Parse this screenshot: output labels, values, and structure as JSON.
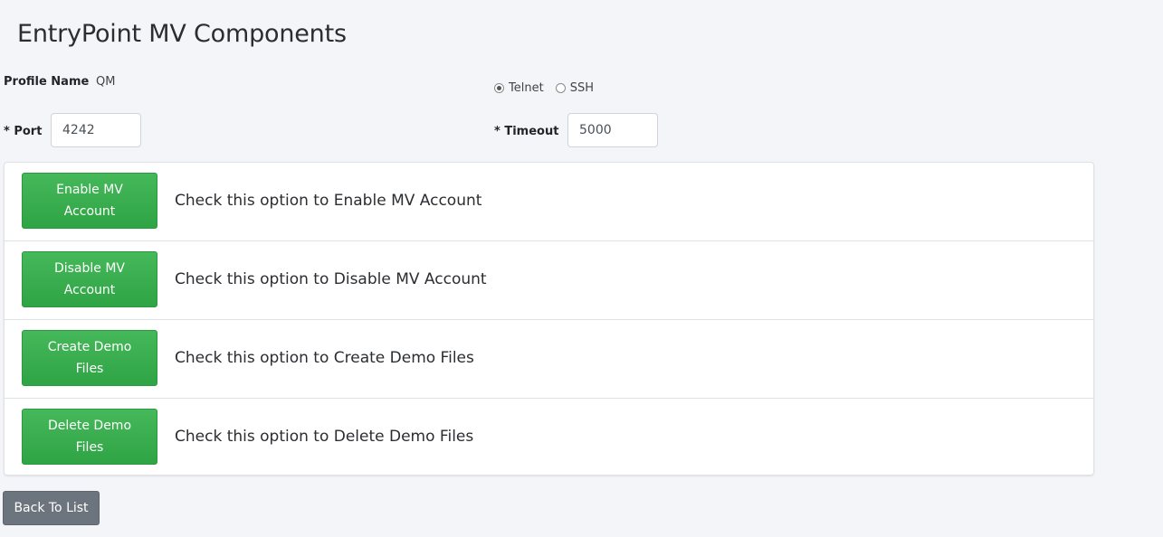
{
  "page": {
    "title": "EntryPoint MV Components"
  },
  "profile": {
    "label": "Profile Name",
    "value": "QM"
  },
  "protocol": {
    "options": [
      {
        "label": "Telnet",
        "checked": true
      },
      {
        "label": "SSH",
        "checked": false
      }
    ]
  },
  "port": {
    "label": "* Port",
    "value": "4242"
  },
  "timeout": {
    "label": "* Timeout",
    "value": "5000"
  },
  "actions": [
    {
      "button_label": "Enable MV Account",
      "description": "Check this option to Enable MV Account"
    },
    {
      "button_label": "Disable MV Account",
      "description": "Check this option to Disable MV Account"
    },
    {
      "button_label": "Create Demo Files",
      "description": "Check this option to Create Demo Files"
    },
    {
      "button_label": "Delete Demo Files",
      "description": "Check this option to Delete Demo Files"
    }
  ],
  "footer": {
    "back_label": "Back To List"
  },
  "colors": {
    "action_button": "#34a94a",
    "back_button": "#6c757d",
    "background": "#f4f5f9"
  }
}
